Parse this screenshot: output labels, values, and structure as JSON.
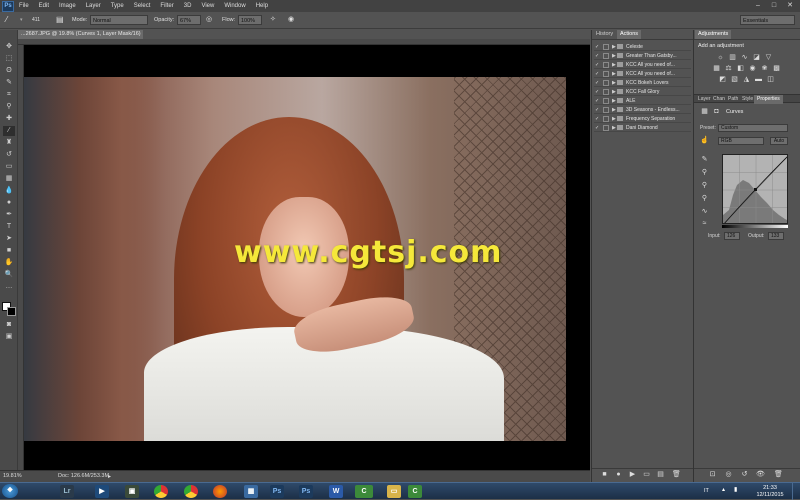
{
  "app": {
    "logo": "Ps",
    "menu": [
      "File",
      "Edit",
      "Image",
      "Layer",
      "Type",
      "Select",
      "Filter",
      "3D",
      "View",
      "Window",
      "Help"
    ],
    "window_controls": [
      "minimize-icon",
      "maximize-icon",
      "close-icon"
    ]
  },
  "options": {
    "brush_size": "411",
    "mode_label": "Mode:",
    "mode_value": "Normal",
    "opacity_label": "Opacity:",
    "opacity_value": "67%",
    "flow_label": "Flow:",
    "flow_value": "100%",
    "workspace": "Essentials"
  },
  "document": {
    "tab_title": "...2687.JPG @ 19.8% (Curves 1, Layer Mask/16) *",
    "watermark": "www.cgtsj.com"
  },
  "status": {
    "zoom": "19.81%",
    "doc_size": "Doc: 126.6M/253.3M"
  },
  "left_panel": {
    "tabs": [
      "History",
      "Actions"
    ],
    "active_tab": "Actions",
    "actions": [
      "Celeste",
      "Greater Than Gatsby...",
      "KCC All you need of...",
      "KCC All you need of...",
      "KCC Bokeh Lovers",
      "KCC Fall Glory",
      "ALE",
      "3D Seasons - Endless...",
      "Frequency Separation",
      "Dani Diamond"
    ]
  },
  "right_panel": {
    "adjustments_tab": "Adjustments",
    "add_adjustment": "Add an adjustment",
    "tabs": [
      "Layer",
      "Chan",
      "Path",
      "Style",
      "Properties"
    ],
    "active_tab": "Properties",
    "properties_title": "Curves",
    "preset_label": "Preset:",
    "preset_value": "Custom",
    "channel_value": "RGB",
    "auto_label": "Auto",
    "input_label": "Input:",
    "input_value": "126",
    "output_label": "Output:",
    "output_value": "133"
  },
  "taskbar": {
    "language": "IT",
    "time": "21:33",
    "date": "12/11/2015",
    "apps": [
      "start-orb-icon",
      "lightroom-icon",
      "media-player-icon",
      "terminal-icon",
      "chrome-icon",
      "chrome-icon",
      "firefox-icon",
      "explorer-icon",
      "photoshop-icon",
      "photoshop-icon",
      "word-icon",
      "camtasia-icon",
      "folder-icon",
      "camtasia-icon"
    ]
  },
  "colors": {
    "chrome_bg": "#535353",
    "menubar_bg": "#424242",
    "watermark": "#f5e83a",
    "taskbar_bg": "#1c2f47"
  }
}
